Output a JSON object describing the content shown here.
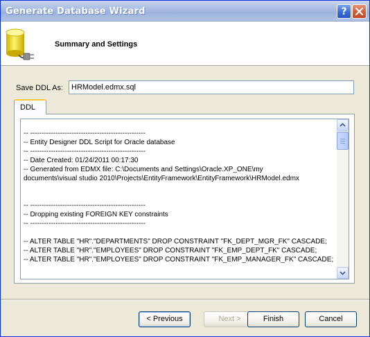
{
  "window": {
    "title": "Generate Database Wizard",
    "help_label": "?",
    "accent": "#0831d9"
  },
  "header": {
    "title": "Summary and Settings",
    "icon": "database-plug-icon"
  },
  "form": {
    "save_label": "Save DDL As:",
    "save_value": "HRModel.edmx.sql"
  },
  "tabs": [
    {
      "label": "DDL",
      "selected": true
    }
  ],
  "ddl": {
    "lines": [
      "-- --------------------------------------------------",
      "-- Entity Designer DDL Script for Oracle database",
      "-- --------------------------------------------------",
      "-- Date Created: 01/24/2011 00:17:30",
      "-- Generated from EDMX file: C:\\Documents and Settings\\Oracle.XP_ONE\\my",
      "documents\\visual studio 2010\\Projects\\EntityFramework\\EntityFramework\\HRModel.edmx",
      "",
      "",
      "-- --------------------------------------------------",
      "-- Dropping existing FOREIGN KEY constraints",
      "-- --------------------------------------------------",
      "",
      "-- ALTER TABLE \"HR\".\"DEPARTMENTS\" DROP CONSTRAINT \"FK_DEPT_MGR_FK\" CASCADE;",
      "-- ALTER TABLE \"HR\".\"EMPLOYEES\" DROP CONSTRAINT \"FK_EMP_DEPT_FK\" CASCADE;",
      "-- ALTER TABLE \"HR\".\"EMPLOYEES\" DROP CONSTRAINT \"FK_EMP_MANAGER_FK\" CASCADE;"
    ]
  },
  "buttons": {
    "previous": "< Previous",
    "next": "Next >",
    "finish": "Finish",
    "cancel": "Cancel"
  }
}
